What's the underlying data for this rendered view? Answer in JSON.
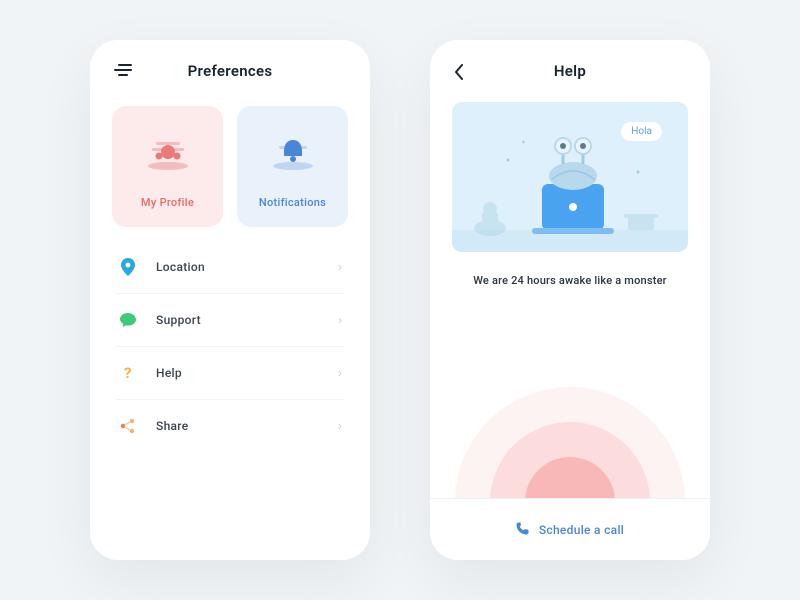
{
  "preferences": {
    "title": "Preferences",
    "cards": {
      "profile": "My Profile",
      "notifications": "Notifications"
    },
    "menu": {
      "location": "Location",
      "support": "Support",
      "help": "Help",
      "share": "Share"
    }
  },
  "help": {
    "title": "Help",
    "speech": "Hola",
    "subtitle": "We are 24 hours awake like a monster",
    "cta": "Schedule a call"
  }
}
